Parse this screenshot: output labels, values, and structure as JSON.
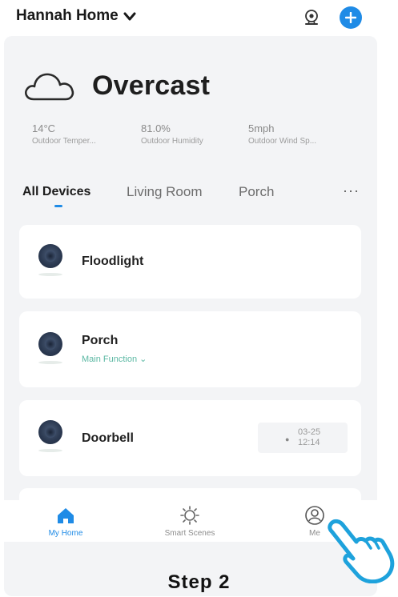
{
  "header": {
    "home_name": "Hannah Home"
  },
  "weather": {
    "condition": "Overcast",
    "stats": [
      {
        "value": "14°C",
        "label": "Outdoor Temper..."
      },
      {
        "value": "81.0%",
        "label": "Outdoor Humidity"
      },
      {
        "value": "5mph",
        "label": "Outdoor Wind Sp..."
      }
    ]
  },
  "tabs": [
    {
      "label": "All Devices",
      "active": true
    },
    {
      "label": "Living Room",
      "active": false
    },
    {
      "label": "Porch",
      "active": false
    }
  ],
  "tabs_more": "···",
  "devices": [
    {
      "name": "Floodlight"
    },
    {
      "name": "Porch",
      "sub": "Main Function ⌄"
    },
    {
      "name": "Doorbell",
      "status_date": "03-25",
      "status_time": "12:14"
    }
  ],
  "bottom_nav": [
    {
      "label": "My Home",
      "active": true
    },
    {
      "label": "Smart Scenes",
      "active": false
    },
    {
      "label": "Me",
      "active": false
    }
  ],
  "caption": "Step 2",
  "colors": {
    "accent": "#1f8be6",
    "sub_text": "#5bb8a3",
    "hand": "#1ea2dc"
  }
}
